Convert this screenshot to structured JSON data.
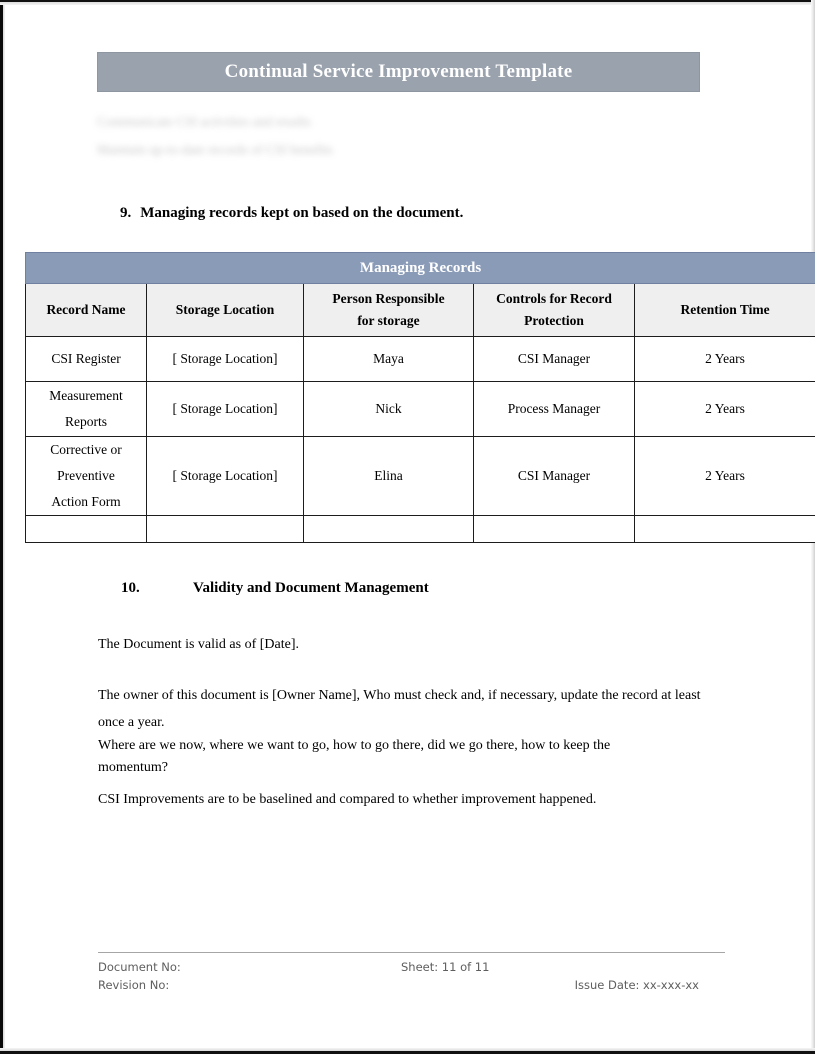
{
  "document": {
    "title": "Continual Service Improvement Template",
    "redacted_lines": [
      "Communicate CSI activities and results",
      "Maintain up-to-date records of CSI benefits"
    ]
  },
  "section_9": {
    "number": "9.",
    "heading": "Managing records kept on based on the document."
  },
  "records_table": {
    "banner": "Managing Records",
    "columns": [
      "Record Name",
      "Storage Location",
      "Person Responsible for storage",
      "Controls for Record Protection",
      "Retention Time"
    ],
    "columns_lines": [
      [
        "Record Name"
      ],
      [
        "Storage Location"
      ],
      [
        "Person Responsible",
        "for storage"
      ],
      [
        "Controls for Record",
        "Protection"
      ],
      [
        "Retention Time"
      ]
    ],
    "rows": [
      {
        "record_name": "CSI Register",
        "record_name_lines": [
          "CSI Register"
        ],
        "storage_location": "[ Storage Location]",
        "person_responsible": "Maya",
        "controls": "CSI Manager",
        "retention_time": "2 Years"
      },
      {
        "record_name": "Measurement Reports",
        "record_name_lines": [
          "Measurement",
          "Reports"
        ],
        "storage_location": "[ Storage Location]",
        "person_responsible": "Nick",
        "controls": "Process Manager",
        "retention_time": "2 Years"
      },
      {
        "record_name": "Corrective or Preventive Action Form",
        "record_name_lines": [
          "Corrective or",
          "Preventive",
          "Action Form"
        ],
        "storage_location": "[ Storage Location]",
        "person_responsible": "Elina",
        "controls": "CSI Manager",
        "retention_time": "2 Years"
      },
      {
        "record_name": "",
        "record_name_lines": [
          ""
        ],
        "storage_location": "",
        "person_responsible": "",
        "controls": "",
        "retention_time": ""
      }
    ]
  },
  "section_10": {
    "number": "10.",
    "heading": "Validity and Document Management",
    "paragraphs": {
      "validity": "The Document is valid as of [Date].",
      "owner": "The owner of this document is [Owner Name], Who must check and, if necessary, update the record at least once a year.",
      "where": "Where are we now, where we want to go, how to go there, did we go there, how to keep the momentum?",
      "csi": "CSI Improvements are to be baselined and compared to whether improvement happened."
    }
  },
  "footer": {
    "document_no": "Document No:",
    "revision_no": "Revision No:",
    "sheet": "Sheet: 11 of 11",
    "issue_date": "Issue Date: xx-xxx-xx"
  },
  "colors": {
    "title_banner": "#9aa2ad",
    "table_banner": "#8a9bb8",
    "table_header_bg": "#efefef",
    "border": "#1d1d1d",
    "footer_text": "#5e5e5e"
  }
}
